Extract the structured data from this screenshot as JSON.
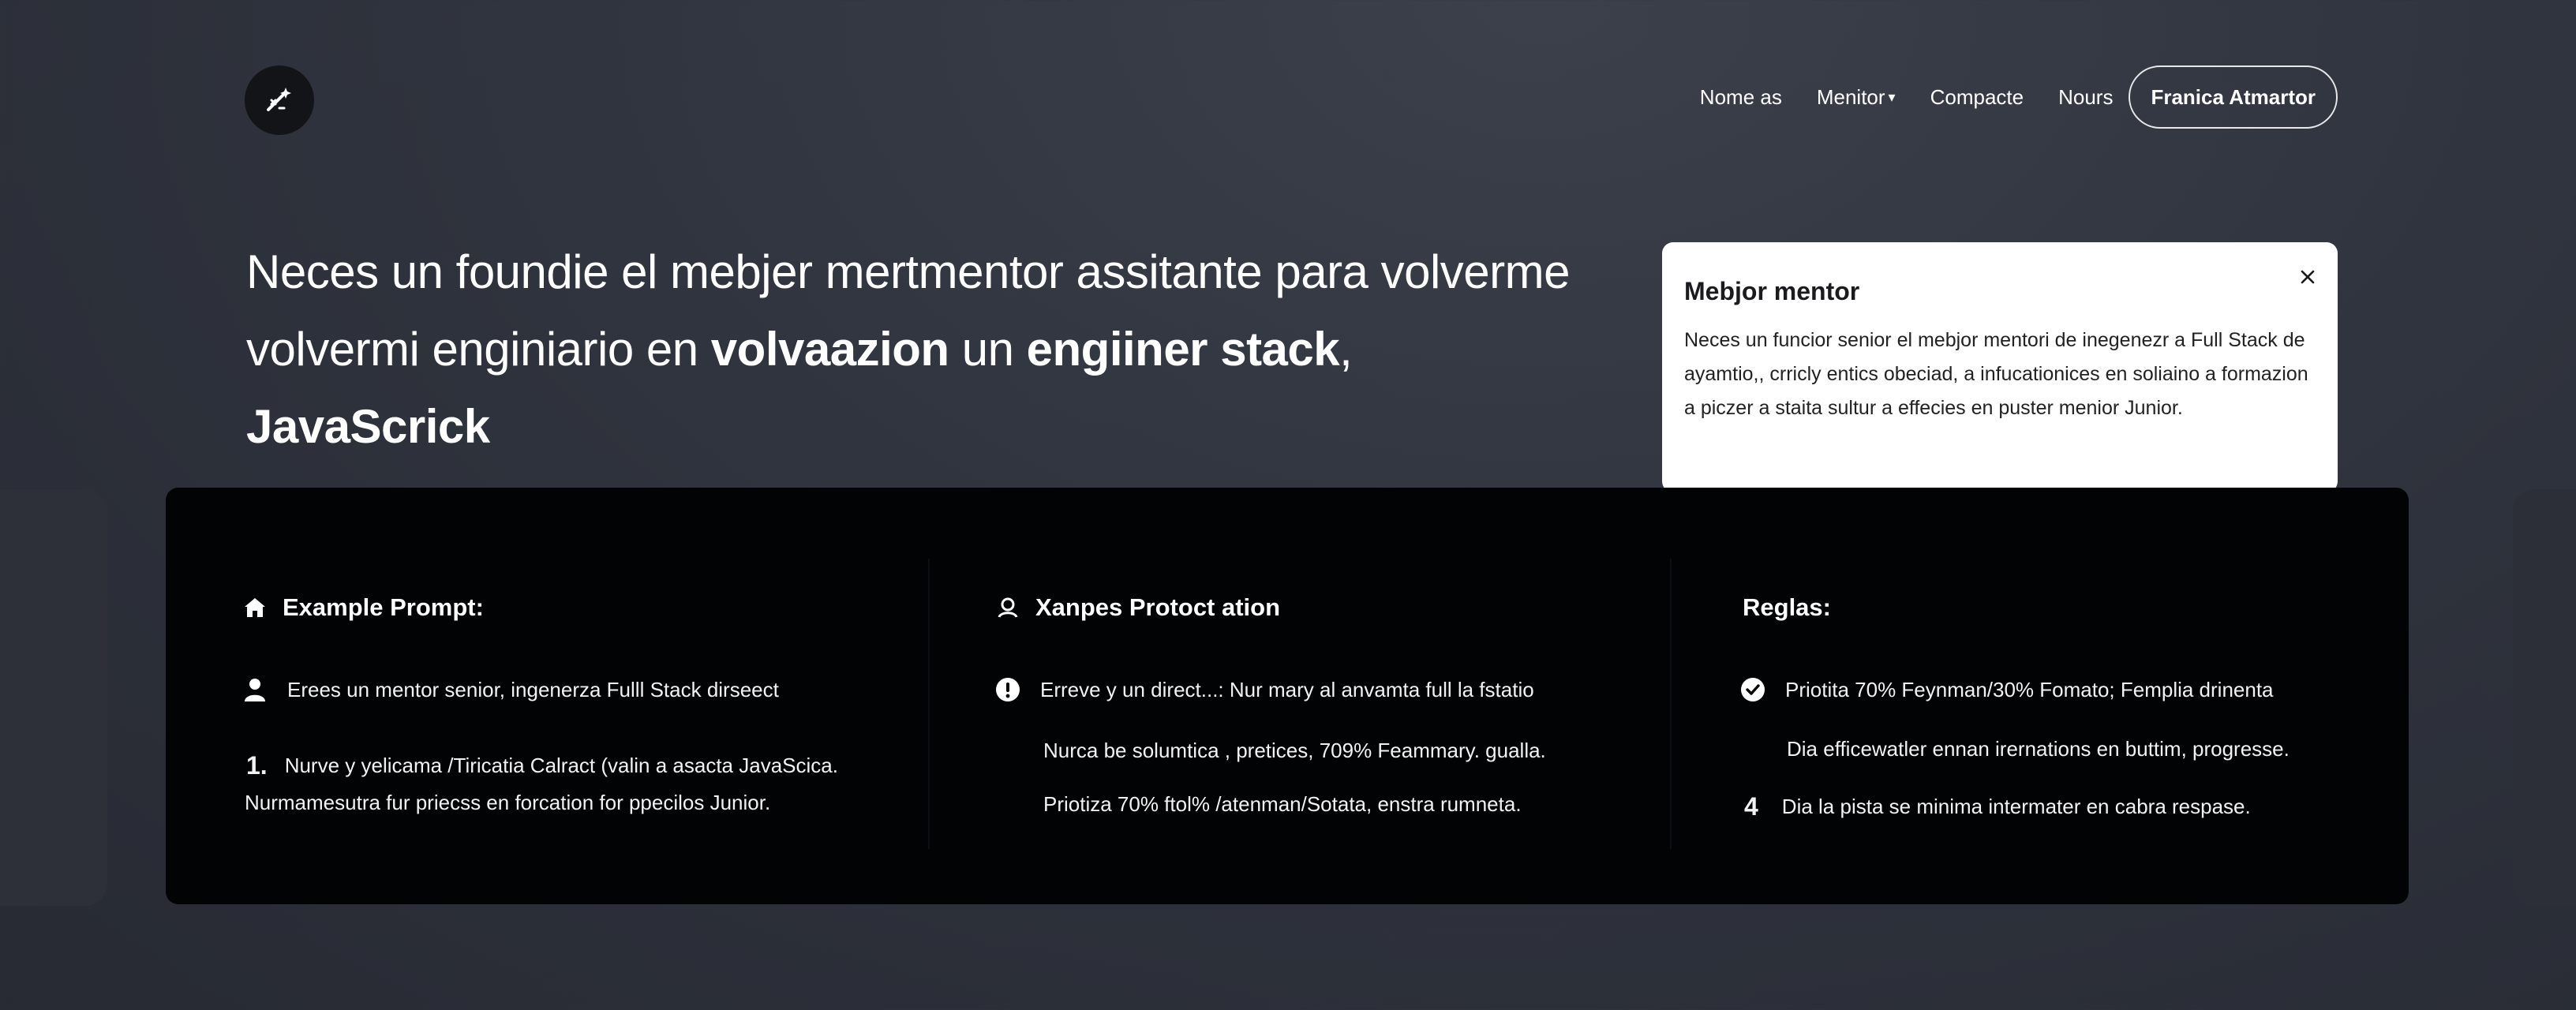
{
  "nav": {
    "items": [
      {
        "label": "Nome as"
      },
      {
        "label": "Menitor"
      },
      {
        "label": "Compacte"
      },
      {
        "label": "Nours"
      }
    ],
    "cta": "Franica Atmartor"
  },
  "hero": {
    "line1": "Neces un foundie el mebjer mertmentor assitante para volverme",
    "line2_plain1": "volvermi enginiario en ",
    "line2_bold1": "volvaazion",
    "line2_plain2": " un ",
    "line2_bold2": "engiiner stack",
    "line2_plain3": ", ",
    "line2_bold3": "JavaScrick"
  },
  "card": {
    "title": "Mebjor mentor",
    "body": "Neces un funcior senior el mebjor mentori de inegenezr a Full Stack de ayamtio,, crricly entics obeciad, a infucationices en soliaino a formazion a piczer a staita sultur a effecies en puster menior Junior."
  },
  "columns": {
    "example": {
      "title": "Example Prompt:",
      "item1": "Erees un mentor senior, ingenerza Fulll Stack dirseect",
      "item2_num": "1.",
      "item2_line1": "Nurve y yelicama /Tiricatia Calract (valin a asacta JavaScica.",
      "item2_line2": "Nurmamesutra fur priecss en forcation for ppecilos Junior."
    },
    "protocol": {
      "title": "Xanpes Protoct ation",
      "item1": "Erreve y un direct...:  Nur mary al anvamta full la fstatio",
      "item2": "Nurca be solumtica , pretices, 709% Feammary. gualla.",
      "item3": "Priotiza 70%  ftol% /atenman/Sotata, enstra rumneta."
    },
    "rules": {
      "title": "Reglas:",
      "item1": "Priotita 70% Feynman/30% Fomato;  Femplia drinenta",
      "item2": "Dia efficewatler ennan irernations en buttim, progresse.",
      "item3_num": "4",
      "item3": "Dia la pista se minima intermater en cabra respase."
    }
  }
}
